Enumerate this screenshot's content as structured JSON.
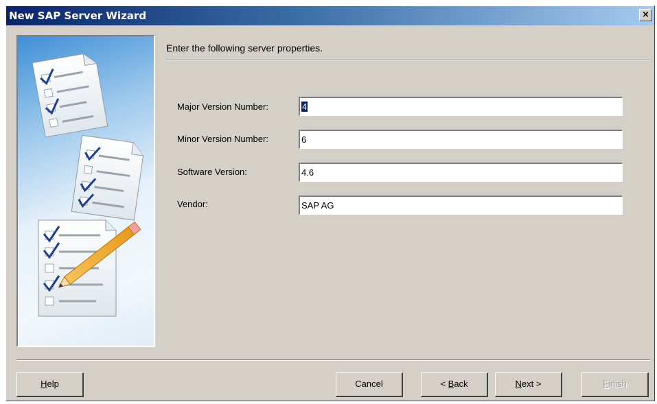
{
  "window": {
    "title": "New SAP Server Wizard",
    "close_label": "×"
  },
  "header": {
    "instruction": "Enter the following server properties."
  },
  "form": {
    "major_version": {
      "label": "Major Version Number:",
      "value": "4"
    },
    "minor_version": {
      "label": "Minor Version Number:",
      "value": "6"
    },
    "software_version": {
      "label": "Software Version:",
      "value": "4.6"
    },
    "vendor": {
      "label": "Vendor:",
      "value": "SAP AG"
    }
  },
  "buttons": {
    "help": {
      "prefix": "",
      "key": "H",
      "suffix": "elp"
    },
    "cancel": {
      "label": "Cancel"
    },
    "back": {
      "prefix": "< ",
      "key": "B",
      "suffix": "ack"
    },
    "next": {
      "prefix": "",
      "key": "N",
      "suffix": "ext >"
    },
    "finish": {
      "prefix": "",
      "key": "F",
      "suffix": "inish"
    }
  },
  "colors": {
    "dialog_face": "#d4d0c8",
    "title_bar_start": "#0a246a",
    "title_bar_end": "#a6caf0",
    "selection": "#0a246a"
  }
}
